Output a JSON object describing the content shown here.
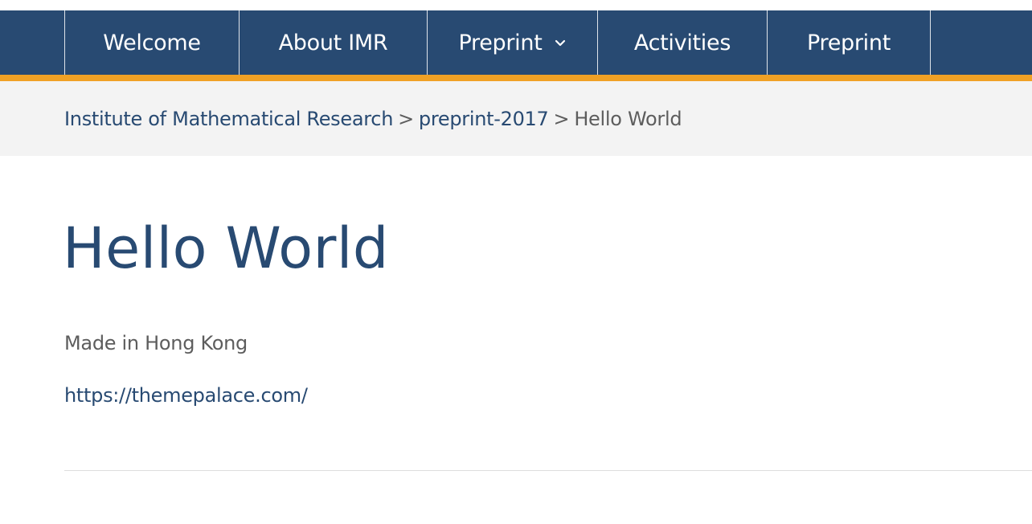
{
  "nav": {
    "items": [
      {
        "label": "Welcome",
        "has_dropdown": false
      },
      {
        "label": "About IMR",
        "has_dropdown": false
      },
      {
        "label": "Preprint",
        "has_dropdown": true
      },
      {
        "label": "Activities",
        "has_dropdown": false
      },
      {
        "label": "Preprint",
        "has_dropdown": false
      }
    ]
  },
  "breadcrumb": {
    "items": [
      "Institute of Mathematical Research",
      "preprint-2017"
    ],
    "separator": ">",
    "current": "Hello World"
  },
  "main": {
    "title": "Hello World",
    "text": "Made in Hong Kong",
    "link": "https://themepalace.com/"
  },
  "colors": {
    "nav_background": "#284a72",
    "nav_accent": "#f0a125",
    "breadcrumb_background": "#f3f3f3",
    "link": "#284a72",
    "body_text": "#5d5d5d"
  },
  "icons": {
    "dropdown": "chevron-down-icon"
  }
}
